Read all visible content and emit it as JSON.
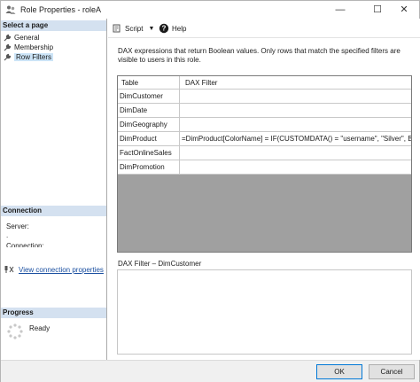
{
  "window": {
    "title": "Role Properties - roleA",
    "minimize_glyph": "—",
    "maximize_glyph": "☐",
    "close_glyph": "✕"
  },
  "left_panel": {
    "select_page_header": "Select a page",
    "pages": [
      {
        "label": "General",
        "icon": "wrench-icon",
        "selected": false
      },
      {
        "label": "Membership",
        "icon": "wrench-icon",
        "selected": false
      },
      {
        "label": "Row Filters",
        "icon": "wrench-icon",
        "selected": true
      }
    ],
    "connection_header": "Connection",
    "server_label": "Server:",
    "server_value": ".",
    "connection_label": "Connection:",
    "view_connection_link": "View connection properties",
    "progress_header": "Progress",
    "progress_status": "Ready"
  },
  "toolbar": {
    "script_label": "Script",
    "script_dropdown": "▼",
    "help_label": "Help"
  },
  "description": "DAX expressions that return Boolean values. Only rows that match the specified filters are visible to users in this role.",
  "grid": {
    "columns": [
      "Table",
      "DAX Filter"
    ],
    "rows": [
      {
        "table": "DimCustomer",
        "filter": ""
      },
      {
        "table": "DimDate",
        "filter": ""
      },
      {
        "table": "DimGeography",
        "filter": ""
      },
      {
        "table": "DimProduct",
        "filter": "=DimProduct[ColorName] = IF(CUSTOMDATA() = \"username\", \"Silver\", BLA..."
      },
      {
        "table": "FactOnlineSales",
        "filter": ""
      },
      {
        "table": "DimPromotion",
        "filter": ""
      }
    ]
  },
  "filter_editor_label": "DAX Filter – DimCustomer",
  "buttons": {
    "ok": "OK",
    "cancel": "Cancel"
  },
  "colors": {
    "section_header_bg": "#d4e1f0",
    "link": "#1a4fa0",
    "grid_empty_bg": "#a0a0a0",
    "ok_border": "#0078d7"
  }
}
